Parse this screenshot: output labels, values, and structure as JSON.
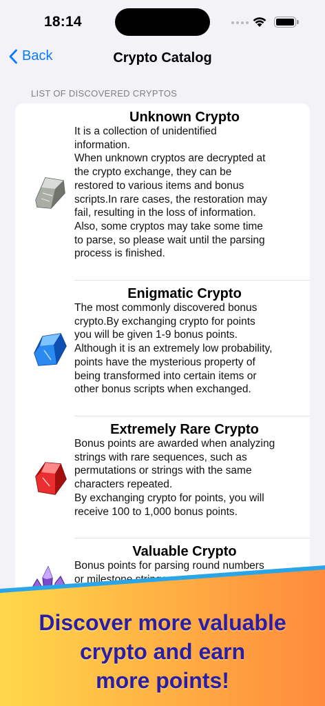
{
  "status_bar": {
    "time": "18:14"
  },
  "nav": {
    "back_label": "Back",
    "title": "Crypto Catalog"
  },
  "section_header": "LIST OF DISCOVERED CRYPTOS",
  "cryptos": [
    {
      "name": "Unknown Crypto",
      "gem_color": "#9aa09a",
      "lines": [
        "It is a collection of unidentified",
        "information.",
        "When unknown cryptos are decrypted at",
        "the crypto exchange, they can be",
        "restored to various items and bonus",
        "scripts.In rare cases, the restoration may",
        "fail, resulting in the loss of information.",
        "Also, some cryptos may take some time",
        "to parse, so please wait until the parsing",
        "process is finished."
      ]
    },
    {
      "name": "Enigmatic Crypto",
      "gem_color": "#1e7be8",
      "lines": [
        "The most commonly discovered bonus",
        "crypto.By exchanging crypto for points",
        "you will be given 1-9 bonus points.",
        "Although it is an extremely low probability,",
        "points have the mysterious property of",
        "being transformed into certain items or",
        "other bonus scripts when exchanged."
      ]
    },
    {
      "name": "Extremely Rare Crypto",
      "gem_color": "#e02424",
      "lines": [
        "Bonus points are awarded when analyzing",
        "strings with rare sequences, such as",
        "permutations or strings with the same",
        "characters repeated.",
        "By exchanging crypto for points, you will",
        "receive 100 to 1,000 bonus points."
      ]
    },
    {
      "name": "Valuable Crypto",
      "gem_color": "#8a5bd0",
      "lines": [
        "Bonus points for parsing round numbers",
        "or milestone strings."
      ]
    }
  ],
  "banner": {
    "lines": [
      "Discover more valuable",
      "crypto and earn",
      "more points!"
    ],
    "color_left": "#ffd84a",
    "color_right": "#ff8a3c",
    "stripe_color": "#2aa5e8",
    "text_color": "#2a1fa3"
  }
}
